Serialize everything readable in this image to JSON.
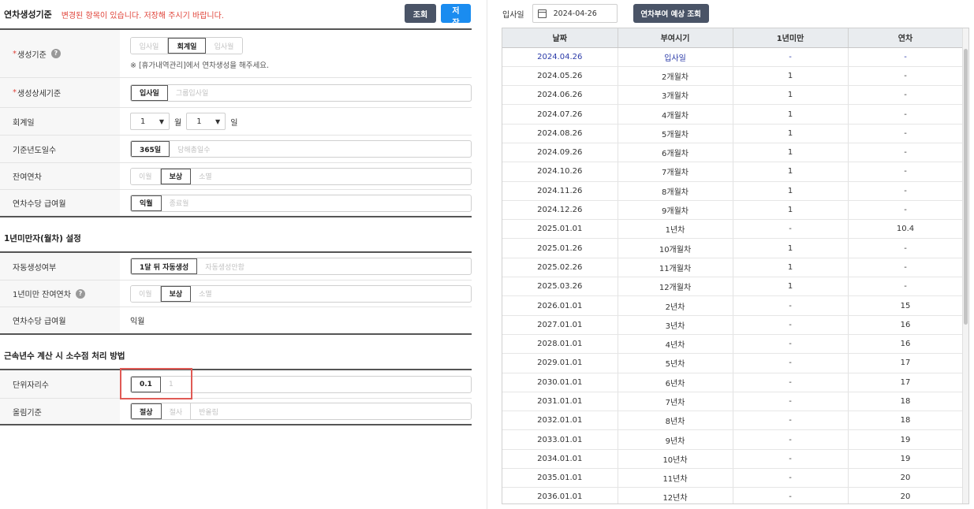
{
  "header": {
    "title": "연차생성기준",
    "warning": "변경된 항목이 있습니다. 저장해 주시기 바랍니다.",
    "search_label": "조회",
    "save_label": "저장"
  },
  "basis": {
    "label": "생성기준",
    "options": [
      "입사일",
      "회계일",
      "입사월"
    ],
    "note": "※ [휴가내역관리]에서 연차생성을 해주세요."
  },
  "detail_basis": {
    "label": "생성상세기준",
    "options": [
      "입사일",
      "그룹입사일"
    ]
  },
  "fiscal_day": {
    "label": "회계일",
    "month": "1",
    "month_unit": "월",
    "day": "1",
    "day_unit": "일"
  },
  "base_year_days": {
    "label": "기준년도일수",
    "options": [
      "365일",
      "당해총일수"
    ]
  },
  "remaining_leave": {
    "label": "잔여연차",
    "options": [
      "이월",
      "보상",
      "소멸"
    ]
  },
  "pay_month": {
    "label": "연차수당 급여월",
    "options": [
      "익월",
      "종료월"
    ]
  },
  "section_under1": {
    "title": "1년미만자(월차) 설정",
    "auto_gen": {
      "label": "자동생성여부",
      "options": [
        "1달 뒤 자동생성",
        "자동생성안함"
      ]
    },
    "remaining": {
      "label": "1년미만 잔여연차",
      "options": [
        "이월",
        "보상",
        "소멸"
      ]
    },
    "pay_month": {
      "label": "연차수당 급여월",
      "value": "익월"
    }
  },
  "section_decimal": {
    "title": "근속년수 계산 시 소수점 처리 방법",
    "unit_digits": {
      "label": "단위자리수",
      "options": [
        "0.1",
        "1"
      ]
    },
    "rounding": {
      "label": "올림기준",
      "options": [
        "절상",
        "절사",
        "반올림"
      ]
    }
  },
  "right": {
    "hire_date_label": "입사일",
    "hire_date": "2024-04-26",
    "preview_label": "연차부여 예상 조회",
    "columns": [
      "날짜",
      "부여시기",
      "1년미만",
      "연차"
    ],
    "rows": [
      [
        "2024.04.26",
        "입사일",
        "-",
        "-"
      ],
      [
        "2024.05.26",
        "2개월차",
        "1",
        "-"
      ],
      [
        "2024.06.26",
        "3개월차",
        "1",
        "-"
      ],
      [
        "2024.07.26",
        "4개월차",
        "1",
        "-"
      ],
      [
        "2024.08.26",
        "5개월차",
        "1",
        "-"
      ],
      [
        "2024.09.26",
        "6개월차",
        "1",
        "-"
      ],
      [
        "2024.10.26",
        "7개월차",
        "1",
        "-"
      ],
      [
        "2024.11.26",
        "8개월차",
        "1",
        "-"
      ],
      [
        "2024.12.26",
        "9개월차",
        "1",
        "-"
      ],
      [
        "2025.01.01",
        "1년차",
        "-",
        "10.4"
      ],
      [
        "2025.01.26",
        "10개월차",
        "1",
        "-"
      ],
      [
        "2025.02.26",
        "11개월차",
        "1",
        "-"
      ],
      [
        "2025.03.26",
        "12개월차",
        "1",
        "-"
      ],
      [
        "2026.01.01",
        "2년차",
        "-",
        "15"
      ],
      [
        "2027.01.01",
        "3년차",
        "-",
        "16"
      ],
      [
        "2028.01.01",
        "4년차",
        "-",
        "16"
      ],
      [
        "2029.01.01",
        "5년차",
        "-",
        "17"
      ],
      [
        "2030.01.01",
        "6년차",
        "-",
        "17"
      ],
      [
        "2031.01.01",
        "7년차",
        "-",
        "18"
      ],
      [
        "2032.01.01",
        "8년차",
        "-",
        "18"
      ],
      [
        "2033.01.01",
        "9년차",
        "-",
        "19"
      ],
      [
        "2034.01.01",
        "10년차",
        "-",
        "19"
      ],
      [
        "2035.01.01",
        "11년차",
        "-",
        "20"
      ],
      [
        "2036.01.01",
        "12년차",
        "-",
        "20"
      ]
    ]
  }
}
